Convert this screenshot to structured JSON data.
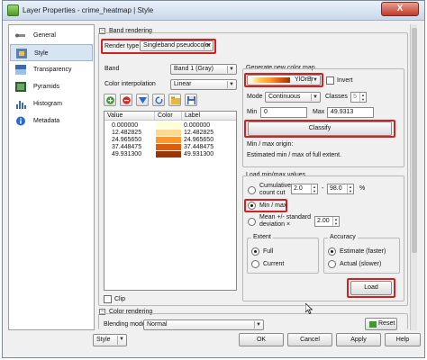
{
  "window": {
    "title": "Layer Properties - crime_heatmap | Style",
    "close": "X"
  },
  "sidebar": {
    "items": [
      {
        "label": "General",
        "icon": "wrench-icon"
      },
      {
        "label": "Style",
        "icon": "paintbrush-icon"
      },
      {
        "label": "Transparency",
        "icon": "transparency-icon"
      },
      {
        "label": "Pyramids",
        "icon": "pyramid-icon"
      },
      {
        "label": "Histogram",
        "icon": "histogram-icon"
      },
      {
        "label": "Metadata",
        "icon": "info-icon"
      }
    ]
  },
  "band_rendering": {
    "title": "Band rendering",
    "render_type_label": "Render type",
    "render_type_value": "Singleband pseudocolor",
    "band_label": "Band",
    "band_value": "Band 1 (Gray)",
    "interp_label": "Color interpolation",
    "interp_value": "Linear",
    "table_headers": [
      "Value",
      "Color",
      "Label"
    ],
    "rows": [
      {
        "value": "0.000000",
        "color": "#ffffd4",
        "label": "0.000000"
      },
      {
        "value": "12.482825",
        "color": "#fed98e",
        "label": "12.482825"
      },
      {
        "value": "24.965650",
        "color": "#fe9929",
        "label": "24.965650"
      },
      {
        "value": "37.448475",
        "color": "#d95f0e",
        "label": "37.448475"
      },
      {
        "value": "49.931300",
        "color": "#993404",
        "label": "49.931300"
      }
    ],
    "clip_label": "Clip"
  },
  "generate": {
    "title": "Generate new color map",
    "ramp_value": "YlOrBr",
    "invert_label": "Invert",
    "mode_label": "Mode",
    "mode_value": "Continuous",
    "classes_label": "Classes",
    "classes_value": "5",
    "min_label": "Min",
    "min_value": "0",
    "max_label": "Max",
    "max_value": "49.9313",
    "classify_label": "Classify",
    "origin_title": "Min / max origin:",
    "origin_text": "Estimated min / max of full extent."
  },
  "load_minmax": {
    "title": "Load min/max values",
    "cumulative_label": "Cumulative count cut",
    "cum_low": "2.0",
    "cum_sep": "-",
    "cum_high": "98.0",
    "cum_unit": "%",
    "minmax_label": "Min / max",
    "mean_label": "Mean +/- standard deviation ×",
    "mean_value": "2.00",
    "extent_title": "Extent",
    "extent_full": "Full",
    "extent_current": "Current",
    "accuracy_title": "Accuracy",
    "accuracy_estimate": "Estimate (faster)",
    "accuracy_actual": "Actual (slower)",
    "load_label": "Load"
  },
  "color_rendering": {
    "title": "Color rendering",
    "blending_label": "Blending mode",
    "blending_value": "Normal",
    "reset_label": "Reset"
  },
  "footer": {
    "style_label": "Style",
    "ok": "OK",
    "cancel": "Cancel",
    "apply": "Apply",
    "help": "Help"
  },
  "colors": {
    "highlight_red": "#d62020",
    "ramp_start": "#ffffd4",
    "ramp_end": "#993404"
  }
}
